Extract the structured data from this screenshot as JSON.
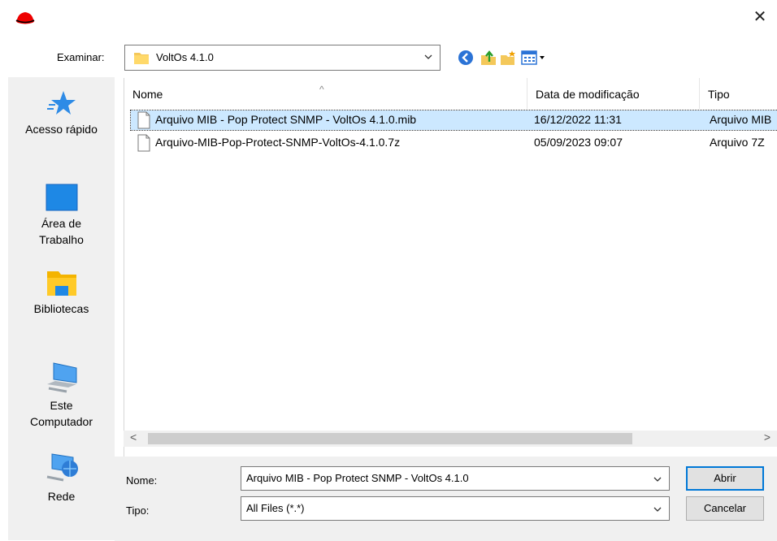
{
  "window": {
    "close_glyph": "✕",
    "app_icon": "red-hat-icon"
  },
  "look_in": {
    "label": "Examinar:",
    "value": "VoltOs 4.1.0"
  },
  "toolbar": {
    "icons": [
      "back-icon",
      "up-folder-icon",
      "new-folder-icon",
      "view-menu-icon"
    ]
  },
  "sidebar": {
    "items": [
      {
        "label": "Acesso rápido",
        "icon": "quick-access-star-icon"
      },
      {
        "label": "Área de Trabalho",
        "icon": "desktop-icon"
      },
      {
        "label": "Bibliotecas",
        "icon": "libraries-icon"
      },
      {
        "label": "Este Computador",
        "icon": "this-pc-icon"
      },
      {
        "label": "Rede",
        "icon": "network-icon"
      }
    ]
  },
  "columns": {
    "name": "Nome",
    "date": "Data de modificação",
    "type": "Tipo",
    "sort_arrow": "^"
  },
  "files": [
    {
      "name": "Arquivo MIB - Pop Protect SNMP - VoltOs 4.1.0.mib",
      "date": "16/12/2022 11:31",
      "type": "Arquivo MIB",
      "selected": true
    },
    {
      "name": "Arquivo-MIB-Pop-Protect-SNMP-VoltOs-4.1.0.7z",
      "date": "05/09/2023 09:07",
      "type": "Arquivo 7Z",
      "selected": false
    }
  ],
  "scroll": {
    "left": "<",
    "right": ">"
  },
  "bottom": {
    "name_label": "Nome:",
    "name_value": "Arquivo MIB - Pop Protect SNMP - VoltOs 4.1.0",
    "type_label": "Tipo:",
    "type_value": "All Files (*.*)",
    "open_button": "Abrir",
    "cancel_button": "Cancelar"
  },
  "colors": {
    "selection": "#cce8ff",
    "accent": "#0078d7",
    "redhat": "#ee0000"
  }
}
